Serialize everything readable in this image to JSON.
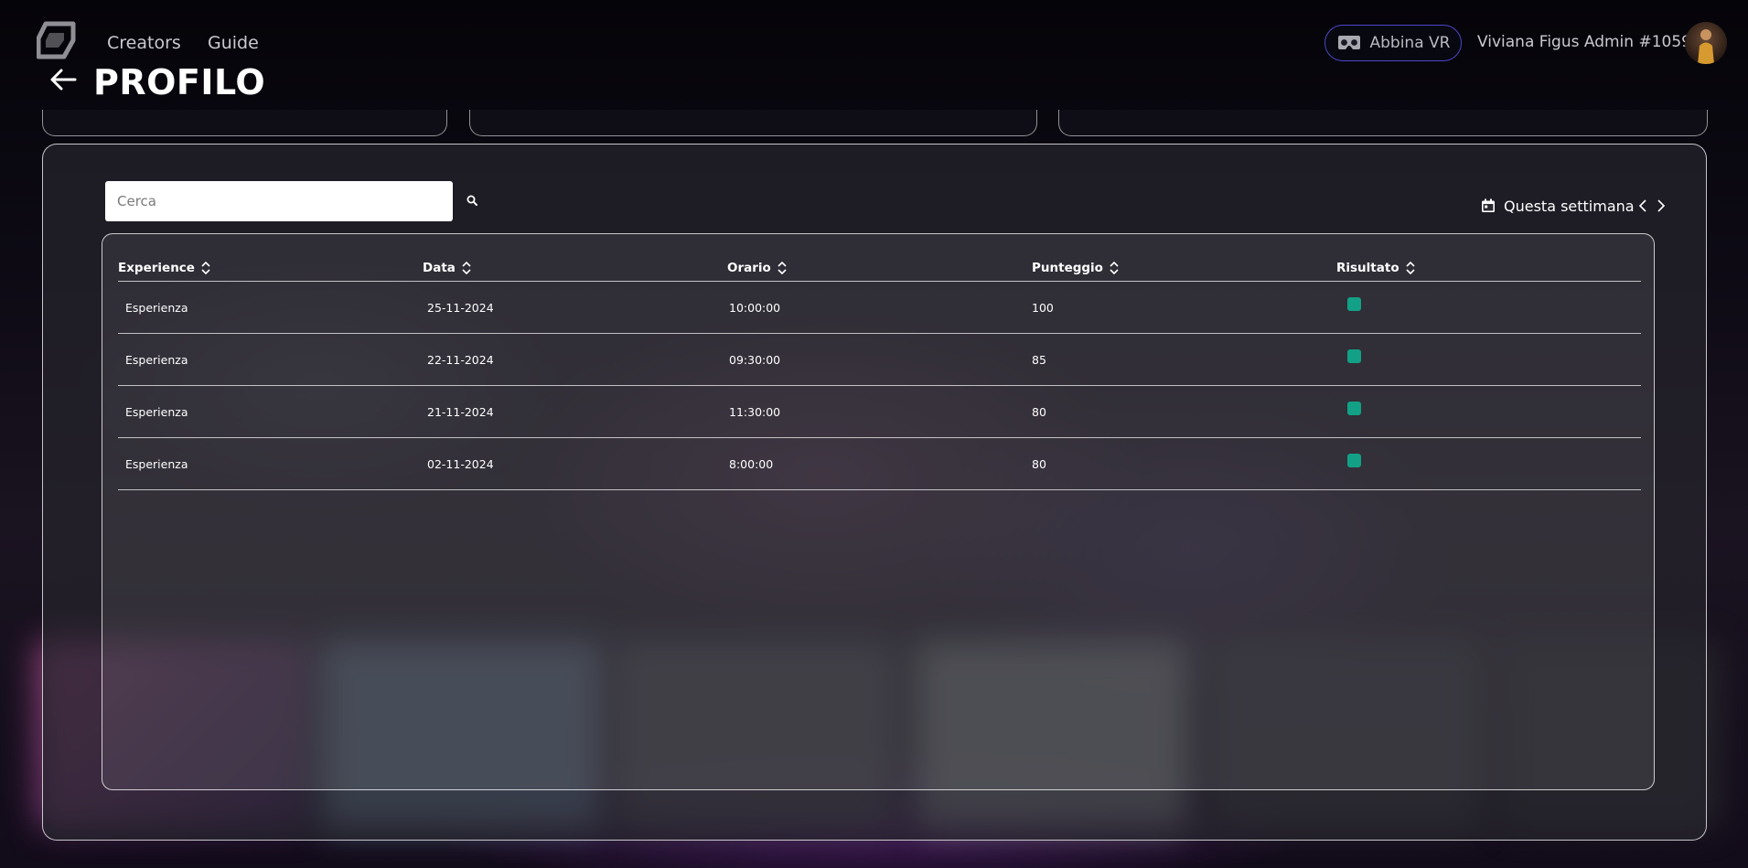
{
  "nav": {
    "links": [
      "Creators",
      "Guide"
    ],
    "vr_button": "Abbina VR",
    "user_name": "Viviana Figus Admin #1059"
  },
  "page": {
    "title": "PROFILO"
  },
  "search": {
    "placeholder": "Cerca"
  },
  "filter": {
    "week_label": "Questa settimana"
  },
  "table": {
    "columns": [
      "Experience",
      "Data",
      "Orario",
      "Punteggio",
      "Risultato"
    ],
    "rows": [
      {
        "experience": "Esperienza",
        "date": "25-11-2024",
        "time": "10:00:00",
        "score": "100",
        "result": true
      },
      {
        "experience": "Esperienza",
        "date": "22-11-2024",
        "time": "09:30:00",
        "score": "85",
        "result": true
      },
      {
        "experience": "Esperienza",
        "date": "21-11-2024",
        "time": "11:30:00",
        "score": "80",
        "result": true
      },
      {
        "experience": "Esperienza",
        "date": "02-11-2024",
        "time": "8:00:00",
        "score": "80",
        "result": true
      }
    ]
  },
  "colors": {
    "background": "#07060b",
    "vr_border": "#4c46c8",
    "check_green": "#12a086"
  },
  "icons": [
    "logo-icon",
    "vr-headset-icon",
    "arrow-left-icon",
    "search-icon",
    "calendar-icon",
    "chevron-left-icon",
    "chevron-right-icon",
    "sort-icon",
    "checkbox-icon"
  ]
}
